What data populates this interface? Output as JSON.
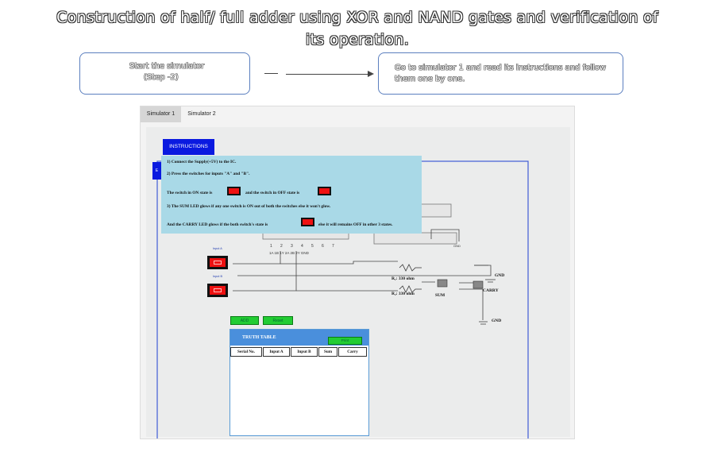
{
  "slide": {
    "title": "Construction of half/ full adder using XOR and NAND gates and verification of its operation.",
    "step1_line1": "Start the simulator",
    "step1_line2": "(Step -2)",
    "step2_line1": "Go to simulator 1 and read its instructions and follow",
    "step2_line2": "them one by one."
  },
  "tabs": [
    "Simulator 1",
    "Simulator 2"
  ],
  "instructions": {
    "button": "INSTRUCTIONS",
    "edge_tab": "E",
    "line1": "1) Connect the Supply(+5V) to the IC.",
    "line2": "2) Press the switches for inputs \"A\" and \"B\".",
    "line3a": "The switch in ON state is",
    "line3b": "and the switch in OFF state is",
    "line4": "3) The SUM LED glows if any one switch is ON out of both the switches else it won't glow.",
    "line5a": "And the CARRY LED glows if the both switch's state is",
    "line5b": "else it will remains OFF in other 3 states."
  },
  "circuit": {
    "input_a": "Input A",
    "input_b": "Input B",
    "pins_top": [
      "1",
      "2",
      "3",
      "4",
      "5",
      "6",
      "7"
    ],
    "pins_label": "1A  1B  1Y  2A  2B  2Y GND",
    "r1": "R₁: 330 ohm",
    "r2": "R₂: 330 ohm",
    "sum": "SUM",
    "carry": "CARRY",
    "gnd": "GND",
    "gnd_small": "GND"
  },
  "controls": {
    "add": "ADD",
    "reset": "Reset"
  },
  "truth_table": {
    "title": "TRUTH TABLE",
    "print": "Print",
    "columns": [
      "Serial No.",
      "Input A",
      "Input B",
      "Sum",
      "Carry"
    ]
  },
  "colors": {
    "accent_blue": "#0a1ae0",
    "panel": "#a9d9e7",
    "switch_red": "#e11",
    "button_green": "#22cc33",
    "table_header": "#4a8fdc"
  }
}
